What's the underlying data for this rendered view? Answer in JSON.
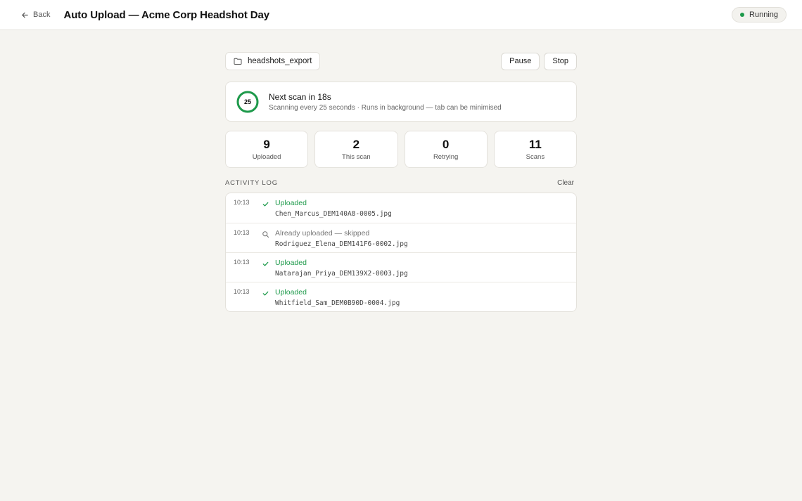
{
  "header": {
    "back_label": "Back",
    "title": "Auto Upload — Acme Corp Headshot Day",
    "status": "Running",
    "status_color": "#1e9a4b"
  },
  "toolbar": {
    "folder_icon": "folder-icon",
    "folder_name": "headshots_export",
    "pause_label": "Pause",
    "stop_label": "Stop"
  },
  "scan": {
    "countdown": "25",
    "countdown_progress": 1.0,
    "title": "Next scan in 18s",
    "subtitle": "Scanning every 25 seconds · Runs in background — tab can be minimised"
  },
  "stats": [
    {
      "value": "9",
      "label": "Uploaded"
    },
    {
      "value": "2",
      "label": "This scan"
    },
    {
      "value": "0",
      "label": "Retrying"
    },
    {
      "value": "11",
      "label": "Scans"
    }
  ],
  "log": {
    "title": "ACTIVITY LOG",
    "clear_label": "Clear",
    "entries": [
      {
        "time": "10:13",
        "icon": "check-icon",
        "status": "Uploaded",
        "file": "Chen_Marcus_DEM140A8-0005.jpg"
      },
      {
        "time": "10:13",
        "icon": "search-icon",
        "status": "Already uploaded — skipped",
        "file": "Rodriguez_Elena_DEM141F6-0002.jpg"
      },
      {
        "time": "10:13",
        "icon": "check-icon",
        "status": "Uploaded",
        "file": "Natarajan_Priya_DEM139X2-0003.jpg"
      },
      {
        "time": "10:13",
        "icon": "check-icon",
        "status": "Uploaded",
        "file": "Whitfield_Sam_DEM0B90D-0004.jpg"
      }
    ]
  },
  "colors": {
    "accent_green": "#1e9a4b",
    "background": "#f5f4f0"
  }
}
